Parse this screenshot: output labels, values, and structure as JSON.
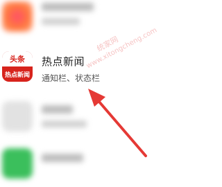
{
  "rows": [
    {
      "kind": "blurred-app"
    },
    {
      "kind": "app",
      "icon": {
        "top_text": "头条",
        "bottom_text": "热点新闻",
        "color": "#d7231c"
      },
      "title": "热点新闻",
      "subtitle": "通知栏、状态栏"
    },
    {
      "kind": "blurred-app"
    },
    {
      "kind": "blurred-app"
    }
  ],
  "overlay": {
    "arrow_color": "#e53935"
  },
  "watermark": {
    "line1": "统家网",
    "line2": "www.xitongcheng.com"
  }
}
